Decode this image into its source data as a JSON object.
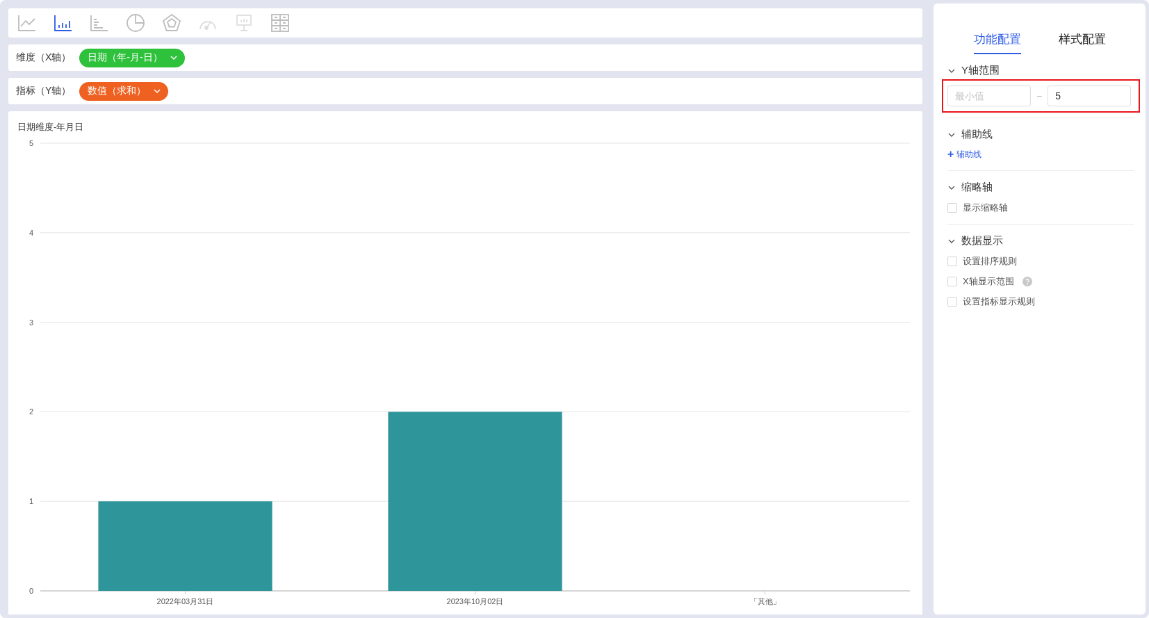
{
  "chart_types": [
    {
      "kind": "line",
      "selected": false,
      "disabled": false
    },
    {
      "kind": "bar",
      "selected": true,
      "disabled": false
    },
    {
      "kind": "hbar",
      "selected": false,
      "disabled": false
    },
    {
      "kind": "pie",
      "selected": false,
      "disabled": false
    },
    {
      "kind": "radar",
      "selected": false,
      "disabled": false
    },
    {
      "kind": "gauge",
      "selected": false,
      "disabled": true
    },
    {
      "kind": "board",
      "selected": false,
      "disabled": true
    },
    {
      "kind": "table",
      "selected": false,
      "disabled": false
    }
  ],
  "fields": [
    {
      "label": "维度（X轴）",
      "value": "日期（年-月-日）",
      "color": "#2ec13b"
    },
    {
      "label": "指标（Y轴）",
      "value": "数值（求和）",
      "color": "#ee6121"
    }
  ],
  "chart_data": {
    "type": "bar",
    "title": "日期维度-年月日",
    "categories": [
      "2022年03月31日",
      "2023年10月02日",
      "「其他」"
    ],
    "series": [
      {
        "color": "#2e969b",
        "values": [
          1,
          2,
          null
        ]
      }
    ],
    "grid": true,
    "ylim": [
      0,
      5
    ],
    "yticks": [
      0,
      1,
      2,
      3,
      4,
      5
    ]
  },
  "panel": {
    "tabs": [
      {
        "label": "功能配置",
        "selected": true
      },
      {
        "label": "样式配置",
        "selected": false
      }
    ],
    "sections": [
      {
        "kind": "range",
        "title": "Y轴范围",
        "expanded": true,
        "highlighted": true,
        "min_placeholder": "最小值",
        "separator": "−",
        "max_value": "5"
      },
      {
        "kind": "add",
        "title": "辅助线",
        "expanded": true,
        "plus": "+",
        "link": "辅助线"
      },
      {
        "kind": "checks",
        "title": "缩略轴",
        "expanded": true,
        "options": [
          {
            "label": "显示缩略轴",
            "checked": false,
            "help": false
          }
        ]
      },
      {
        "kind": "checks",
        "title": "数据显示",
        "expanded": true,
        "options": [
          {
            "label": "设置排序规则",
            "checked": false,
            "help": false
          },
          {
            "label": "X轴显示范围",
            "checked": false,
            "help": true
          },
          {
            "label": "设置指标显示规则",
            "checked": false,
            "help": false
          }
        ]
      }
    ]
  }
}
